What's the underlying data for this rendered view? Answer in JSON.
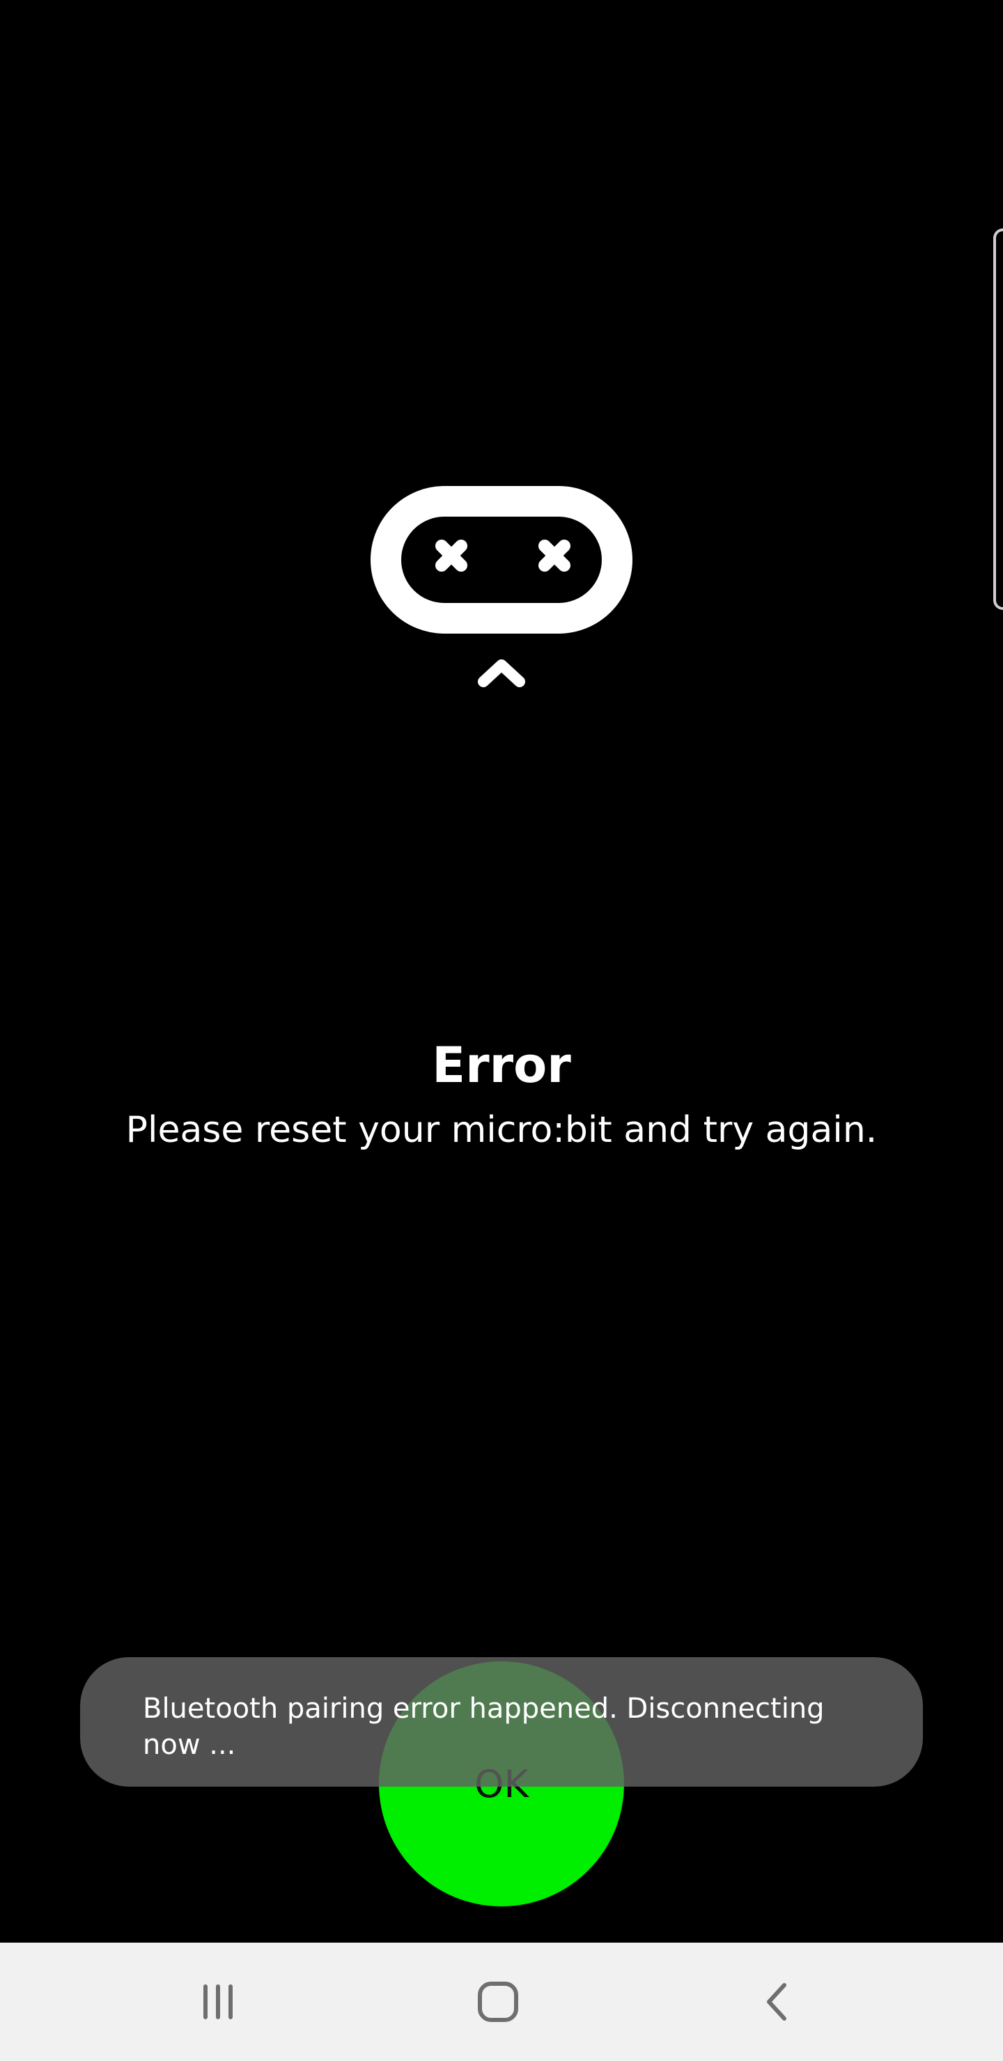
{
  "dialog": {
    "title": "Error",
    "message": "Please reset your micro:bit and try again.",
    "ok_label": "OK"
  },
  "toast": {
    "text": "Bluetooth pairing error happened. Disconnecting now ..."
  },
  "colors": {
    "background": "#000000",
    "ok_button": "#00ee00",
    "toast_bg": "#626262",
    "nav_bar_bg": "#f1f1f1",
    "nav_icon": "#6e6e6e"
  },
  "icons": {
    "logo": "microbit-error-face-icon",
    "pointer": "chevron-up-icon",
    "nav_recents": "recent-apps-icon",
    "nav_home": "home-icon",
    "nav_back": "back-icon"
  }
}
